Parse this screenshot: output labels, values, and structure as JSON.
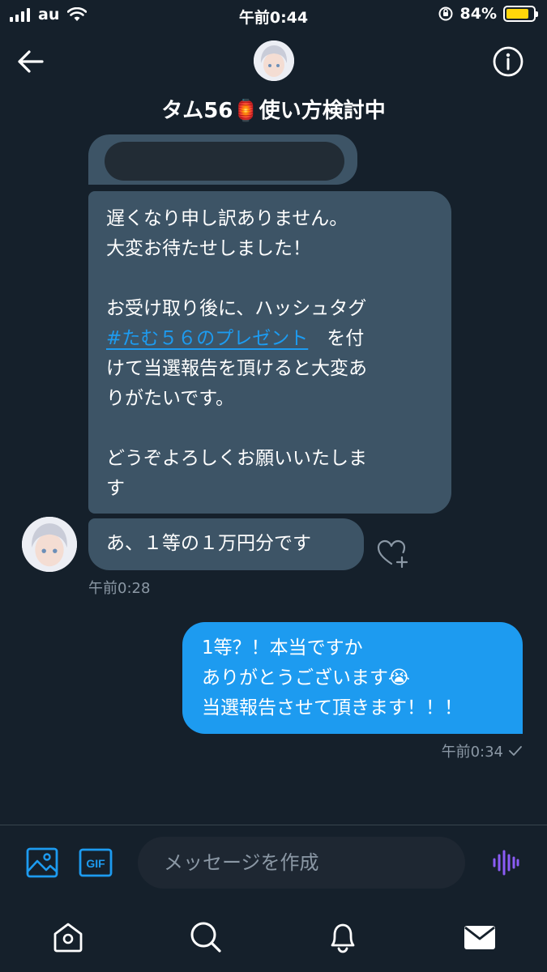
{
  "status_bar": {
    "carrier": "au",
    "time": "午前0:44",
    "battery_percent": "84%",
    "battery_level": 0.84
  },
  "header": {
    "title": "タム56🏮使い方検討中",
    "back_icon": "arrow-left-icon",
    "info_icon": "info-icon"
  },
  "messages": {
    "quoted_redacted": "",
    "incoming_1_lines": [
      "遅くなり申し訳ありません。",
      "大変お待たせしました！",
      "",
      "お受け取り後に、ハッシュタグ",
      "",
      "けて当選報告を頂けると大変あ",
      "りがたいです。",
      "",
      "どうぞよろしくお願いいたしま",
      "す"
    ],
    "hashtag": "#たむ５６のプレゼント",
    "hashtag_suffix": "　を付",
    "incoming_2": "あ、１等の１万円分です",
    "incoming_time": "午前0:28",
    "outgoing_lines": [
      "1等？！本当ですか",
      "ありがとうございます😭",
      "当選報告させて頂きます！！！"
    ],
    "outgoing_time": "午前0:34"
  },
  "composer": {
    "placeholder": "メッセージを作成",
    "gif_label": "GIF"
  },
  "tabs": [
    "home-icon",
    "search-icon",
    "notifications-icon",
    "messages-icon"
  ],
  "colors": {
    "background": "#15202b",
    "incoming_bubble": "#3d5466",
    "outgoing_bubble": "#1d9bf0",
    "accent": "#1d9bf0",
    "muted_text": "#8b98a5",
    "voice_icon": "#8b5cf6"
  }
}
